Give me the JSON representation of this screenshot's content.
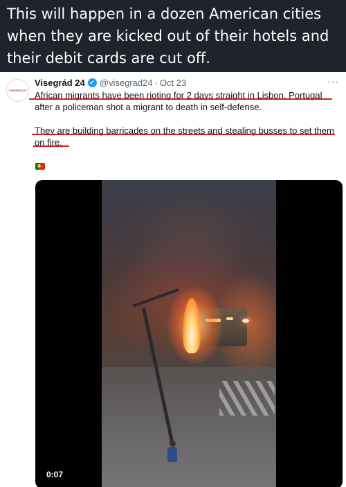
{
  "caption": {
    "lines": [
      "This will happen in a dozen American cities",
      "when they are kicked out of their hotels and",
      "their debit cards are cut off."
    ]
  },
  "tweet": {
    "avatar_text": "VISEGRAD24",
    "author_name": "Visegrád 24",
    "verified_icon": "verified-badge-icon",
    "handle": "@visegrad24",
    "separator": "·",
    "date": "Oct 23",
    "more_icon": "···",
    "body": {
      "paragraph1": [
        "African migrants have been rioting for 2 days straight in Lisbon, Portugal",
        "after a policeman shot a migrant to death in self-defense."
      ],
      "paragraph2": [
        "They are building barricades on the streets and stealing busses to set them",
        "on fire."
      ]
    },
    "flag_icon": "portugal-flag-icon",
    "underline_color": "#d42020",
    "video": {
      "timestamp": "0:07"
    }
  },
  "colors": {
    "caption_bg": "#1f232b",
    "verified": "#1d9bf0",
    "muted": "#536471"
  }
}
